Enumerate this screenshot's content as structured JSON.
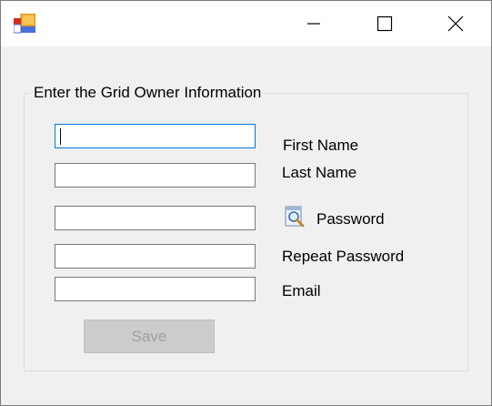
{
  "window": {
    "title": "",
    "controls": {
      "minimize_icon": "minimize-icon",
      "maximize_icon": "maximize-icon",
      "close_icon": "close-icon"
    }
  },
  "group": {
    "title": "Enter the Grid Owner Information"
  },
  "form": {
    "first_name": {
      "label": "First Name",
      "value": ""
    },
    "last_name": {
      "label": "Last Name",
      "value": ""
    },
    "password": {
      "label": "Password",
      "value": "",
      "icon": "password-viewer-icon"
    },
    "repeat_password": {
      "label": "Repeat Password",
      "value": ""
    },
    "email": {
      "label": "Email",
      "value": ""
    }
  },
  "buttons": {
    "save_label": "Save",
    "save_enabled": false
  },
  "colors": {
    "window_bg": "#f0f0f0",
    "titlebar_bg": "#ffffff",
    "focus_border": "#0078d7",
    "disabled_button_bg": "#cccccc",
    "disabled_button_text": "#a0a0a0"
  }
}
